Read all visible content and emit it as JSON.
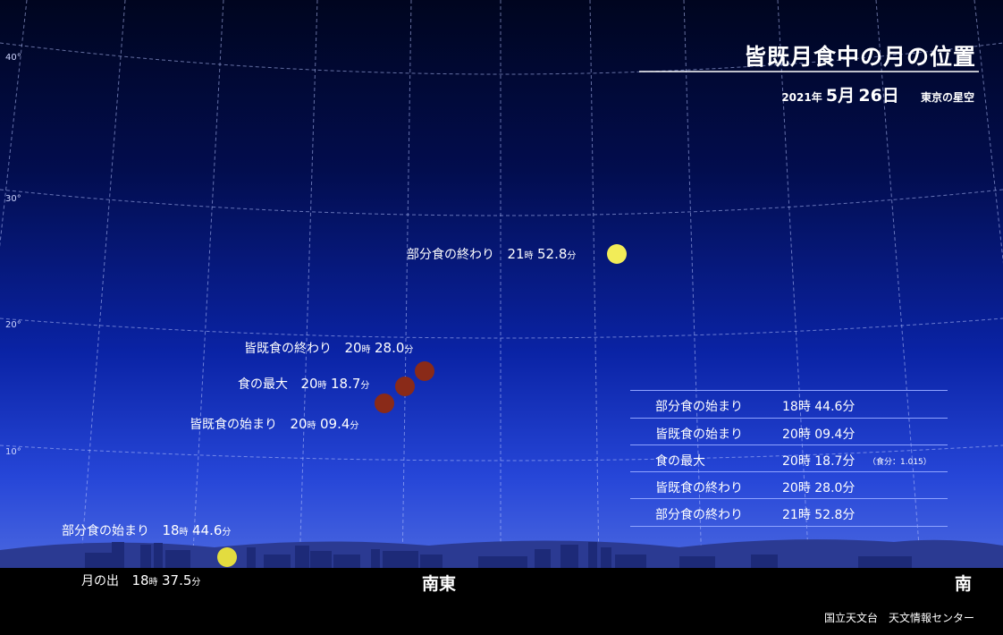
{
  "title": "皆既月食中の月の位置",
  "date": {
    "year": "2021年",
    "month": "5月",
    "day": "26日",
    "place": "東京の星空"
  },
  "altitude_labels": [
    "40°",
    "30°",
    "20°",
    "10°"
  ],
  "moon_labels": {
    "rise": {
      "name": "月の出",
      "hour": "18",
      "hour_unit": "時",
      "min": "37.5",
      "min_unit": "分"
    },
    "partial_start": {
      "name": "部分食の始まり",
      "hour": "18",
      "hour_unit": "時",
      "min": "44.6",
      "min_unit": "分"
    },
    "total_start": {
      "name": "皆既食の始まり",
      "hour": "20",
      "hour_unit": "時",
      "min": "09.4",
      "min_unit": "分"
    },
    "maximum": {
      "name": "食の最大",
      "hour": "20",
      "hour_unit": "時",
      "min": "18.7",
      "min_unit": "分"
    },
    "total_end": {
      "name": "皆既食の終わり",
      "hour": "20",
      "hour_unit": "時",
      "min": "28.0",
      "min_unit": "分"
    },
    "partial_end": {
      "name": "部分食の終わり",
      "hour": "21",
      "hour_unit": "時",
      "min": "52.8",
      "min_unit": "分"
    }
  },
  "table": [
    {
      "name": "部分食の始まり",
      "time": "18時 44.6分",
      "note": ""
    },
    {
      "name": "皆既食の始まり",
      "time": "20時 09.4分",
      "note": ""
    },
    {
      "name": "食の最大",
      "time": "20時 18.7分",
      "note": "（食分：1.015）"
    },
    {
      "name": "皆既食の終わり",
      "time": "20時 28.0分",
      "note": ""
    },
    {
      "name": "部分食の終わり",
      "time": "21時 52.8分",
      "note": ""
    }
  ],
  "directions": {
    "southeast": "南東",
    "south": "南"
  },
  "credit": "国立天文台　天文情報センター",
  "colors": {
    "full_moon": "#f2ec58",
    "eclipsed_moon": "#8a2a18",
    "grid": "#b8c4ff"
  }
}
